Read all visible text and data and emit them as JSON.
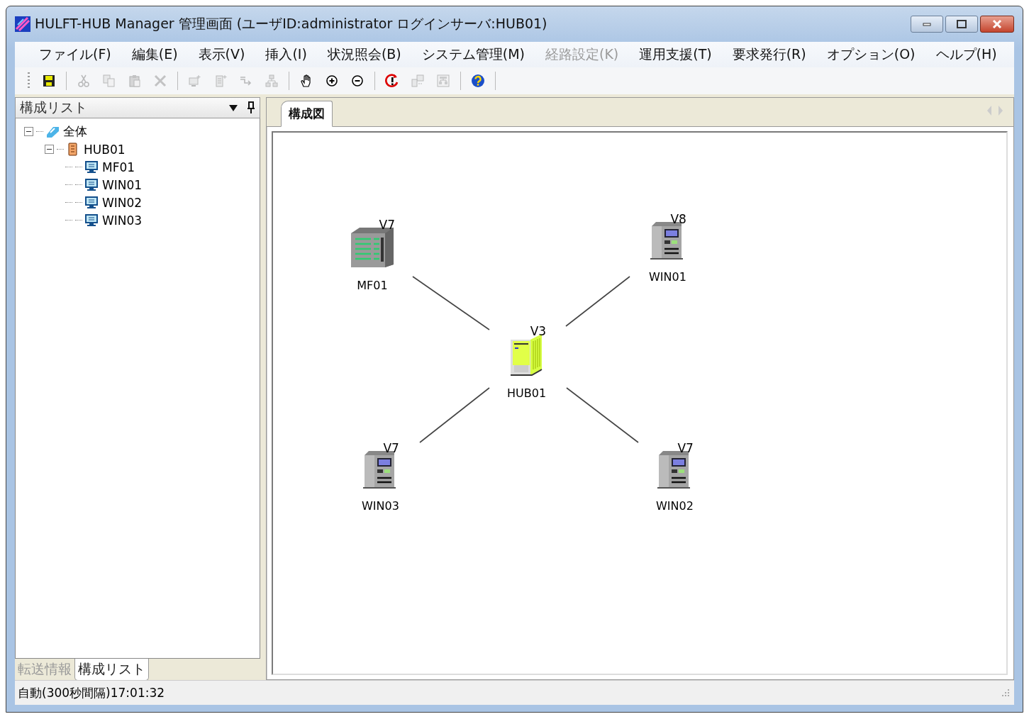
{
  "window": {
    "title": "HULFT-HUB Manager 管理画面 (ユーザID:administrator ログインサーバ:HUB01)"
  },
  "menu": [
    {
      "label": "ファイル(F)",
      "disabled": false
    },
    {
      "label": "編集(E)",
      "disabled": false
    },
    {
      "label": "表示(V)",
      "disabled": false
    },
    {
      "label": "挿入(I)",
      "disabled": false
    },
    {
      "label": "状況照会(B)",
      "disabled": false
    },
    {
      "label": "システム管理(M)",
      "disabled": false
    },
    {
      "label": "経路設定(K)",
      "disabled": true
    },
    {
      "label": "運用支援(T)",
      "disabled": false
    },
    {
      "label": "要求発行(R)",
      "disabled": false
    },
    {
      "label": "オプション(O)",
      "disabled": false
    },
    {
      "label": "ヘルプ(H)",
      "disabled": false
    }
  ],
  "toolbar": [
    {
      "kind": "save",
      "disabled": false
    },
    {
      "kind": "separator"
    },
    {
      "kind": "cut",
      "disabled": true
    },
    {
      "kind": "copy",
      "disabled": true
    },
    {
      "kind": "paste",
      "disabled": true
    },
    {
      "kind": "delete",
      "disabled": true
    },
    {
      "kind": "separator"
    },
    {
      "kind": "add-computer",
      "disabled": true
    },
    {
      "kind": "add-server",
      "disabled": true
    },
    {
      "kind": "add-route",
      "disabled": true
    },
    {
      "kind": "add-network",
      "disabled": true
    },
    {
      "kind": "separator"
    },
    {
      "kind": "hand",
      "disabled": false
    },
    {
      "kind": "zoom-in",
      "disabled": false
    },
    {
      "kind": "zoom-out",
      "disabled": false
    },
    {
      "kind": "separator"
    },
    {
      "kind": "refresh",
      "disabled": false
    },
    {
      "kind": "transfer",
      "disabled": true
    },
    {
      "kind": "layout",
      "disabled": true
    },
    {
      "kind": "separator"
    },
    {
      "kind": "help",
      "disabled": false
    },
    {
      "kind": "separator"
    }
  ],
  "sidebar": {
    "title": "構成リスト",
    "tree": [
      {
        "label": "全体",
        "kind": "root",
        "expanded": true,
        "children": [
          {
            "label": "HUB01",
            "kind": "hub",
            "expanded": true,
            "children": [
              {
                "label": "MF01",
                "kind": "host"
              },
              {
                "label": "WIN01",
                "kind": "host"
              },
              {
                "label": "WIN02",
                "kind": "host"
              },
              {
                "label": "WIN03",
                "kind": "host"
              }
            ]
          }
        ]
      }
    ],
    "tabs": [
      {
        "label": "転送情報",
        "selected": false
      },
      {
        "label": "構成リスト",
        "selected": true
      }
    ]
  },
  "main_tabs": [
    {
      "label": "構成図",
      "selected": true
    }
  ],
  "diagram": {
    "nodes": [
      {
        "name": "MF01",
        "version": "V7",
        "kind": "mainframe"
      },
      {
        "name": "WIN01",
        "version": "V8",
        "kind": "windows"
      },
      {
        "name": "HUB01",
        "version": "V3",
        "kind": "hub"
      },
      {
        "name": "WIN03",
        "version": "V7",
        "kind": "windows"
      },
      {
        "name": "WIN02",
        "version": "V7",
        "kind": "windows"
      }
    ]
  },
  "status_bar": {
    "text": "自動(300秒間隔)17:01:32"
  }
}
